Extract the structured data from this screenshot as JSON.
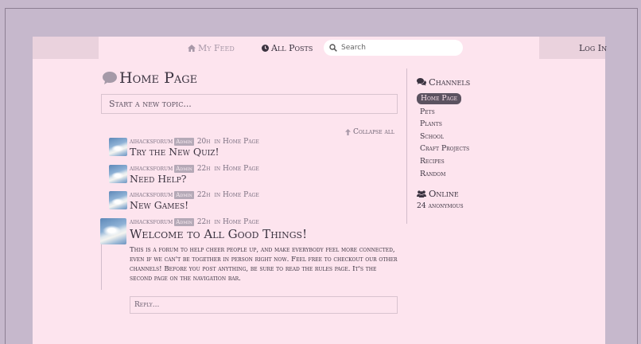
{
  "nav": {
    "my_feed": "My Feed",
    "all_posts": "All Posts",
    "search_placeholder": "Search",
    "log_in": "Log In"
  },
  "page": {
    "title": "Home Page",
    "new_topic": "Start a new topic..."
  },
  "thread": {
    "collapse_all": "Collapse all",
    "posts": [
      {
        "author": "aihacksforum",
        "badge": "Admin",
        "time": "20h",
        "in_text": "in",
        "channel": "Home Page",
        "title": "Try the New Quiz!"
      },
      {
        "author": "aihacksforum",
        "badge": "Admin",
        "time": "22h",
        "in_text": "in",
        "channel": "Home Page",
        "title": "Need Help?"
      },
      {
        "author": "aihacksforum",
        "badge": "Admin",
        "time": "22h",
        "in_text": "in",
        "channel": "Home Page",
        "title": "New Games!"
      },
      {
        "author": "aihacksforum",
        "badge": "Admin",
        "time": "22h",
        "in_text": "in",
        "channel": "Home Page",
        "title": "Welcome to All Good Things!",
        "body": "This is a forum to help cheer people up, and make everybody feel more connected, even if we can't be together in person right now. Feel free to checkout our other channels! Before you post anything, be sure to read the rules page. It's the second page on the navigation bar."
      }
    ],
    "reply_placeholder": "Reply..."
  },
  "sidebar": {
    "channels_heading": "Channels",
    "channels": [
      "Home Page",
      "Pets",
      "Plants",
      "School",
      "Craft Projects",
      "Recipes",
      "Random"
    ],
    "active_channel": "Home Page",
    "online_heading": "Online",
    "online_count": "24",
    "online_label": "anonymous"
  },
  "colors": {
    "background": "#c6b8cc",
    "page": "#fde4ee",
    "topbar_side": "#ead2dd",
    "active_pill": "#5b5260",
    "text": "#3b3340"
  }
}
